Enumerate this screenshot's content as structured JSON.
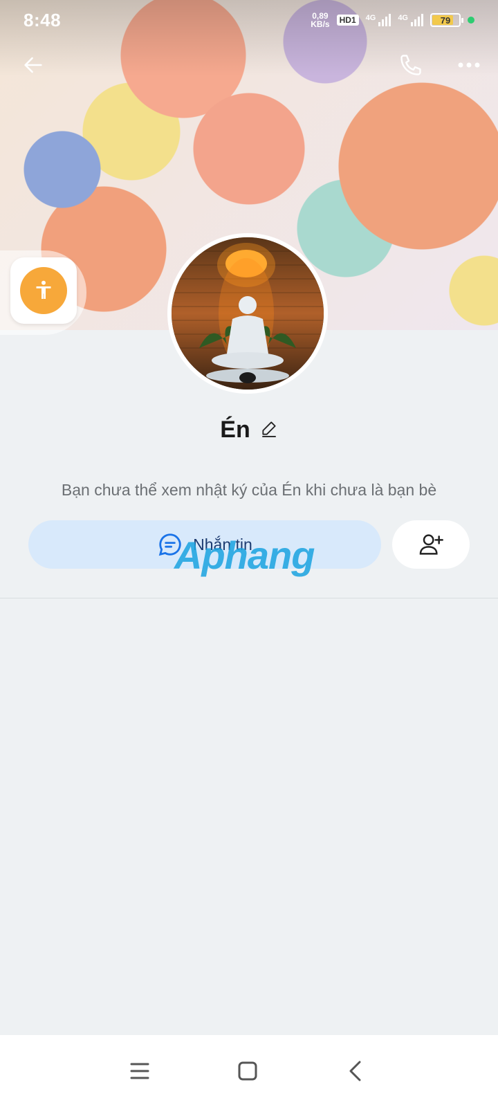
{
  "status_bar": {
    "time": "8:48",
    "net_speed_value": "0,89",
    "net_speed_unit": "KB/s",
    "hd_badge": "HD1",
    "signal1_label": "4G",
    "signal2_label": "4G",
    "battery": "79"
  },
  "profile": {
    "name": "Én",
    "notice": "Bạn chưa thể xem nhật ký của Én khi chưa là bạn bè"
  },
  "actions": {
    "chat_label": "Nhắn tin"
  },
  "watermark": {
    "part1": "Aphang",
    "part2": ""
  },
  "colors": {
    "accent": "#d8e9fb",
    "a11y": "#f7a83a",
    "online": "#2ecc71"
  }
}
